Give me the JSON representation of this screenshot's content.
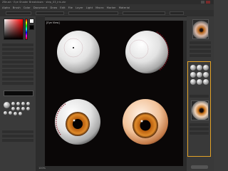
{
  "app": {
    "title_bar": "ZBrush  ·  Eye Shader Breakdown  ·  step_03_iris.zbr"
  },
  "menu": {
    "items": [
      "Alpha",
      "Brush",
      "Color",
      "Document",
      "Draw",
      "Edit",
      "File",
      "Layer",
      "Light",
      "Macro",
      "Marker",
      "Material"
    ]
  },
  "viewport": {
    "label": "[Eye View]"
  },
  "bottom": {
    "zoom_label": "100%"
  },
  "colors": {
    "accent": "#e3a227",
    "iris": "#c9731a",
    "vein": "#8a1020"
  },
  "icons": {
    "close": "close-icon",
    "minimize": "minimize-icon"
  }
}
